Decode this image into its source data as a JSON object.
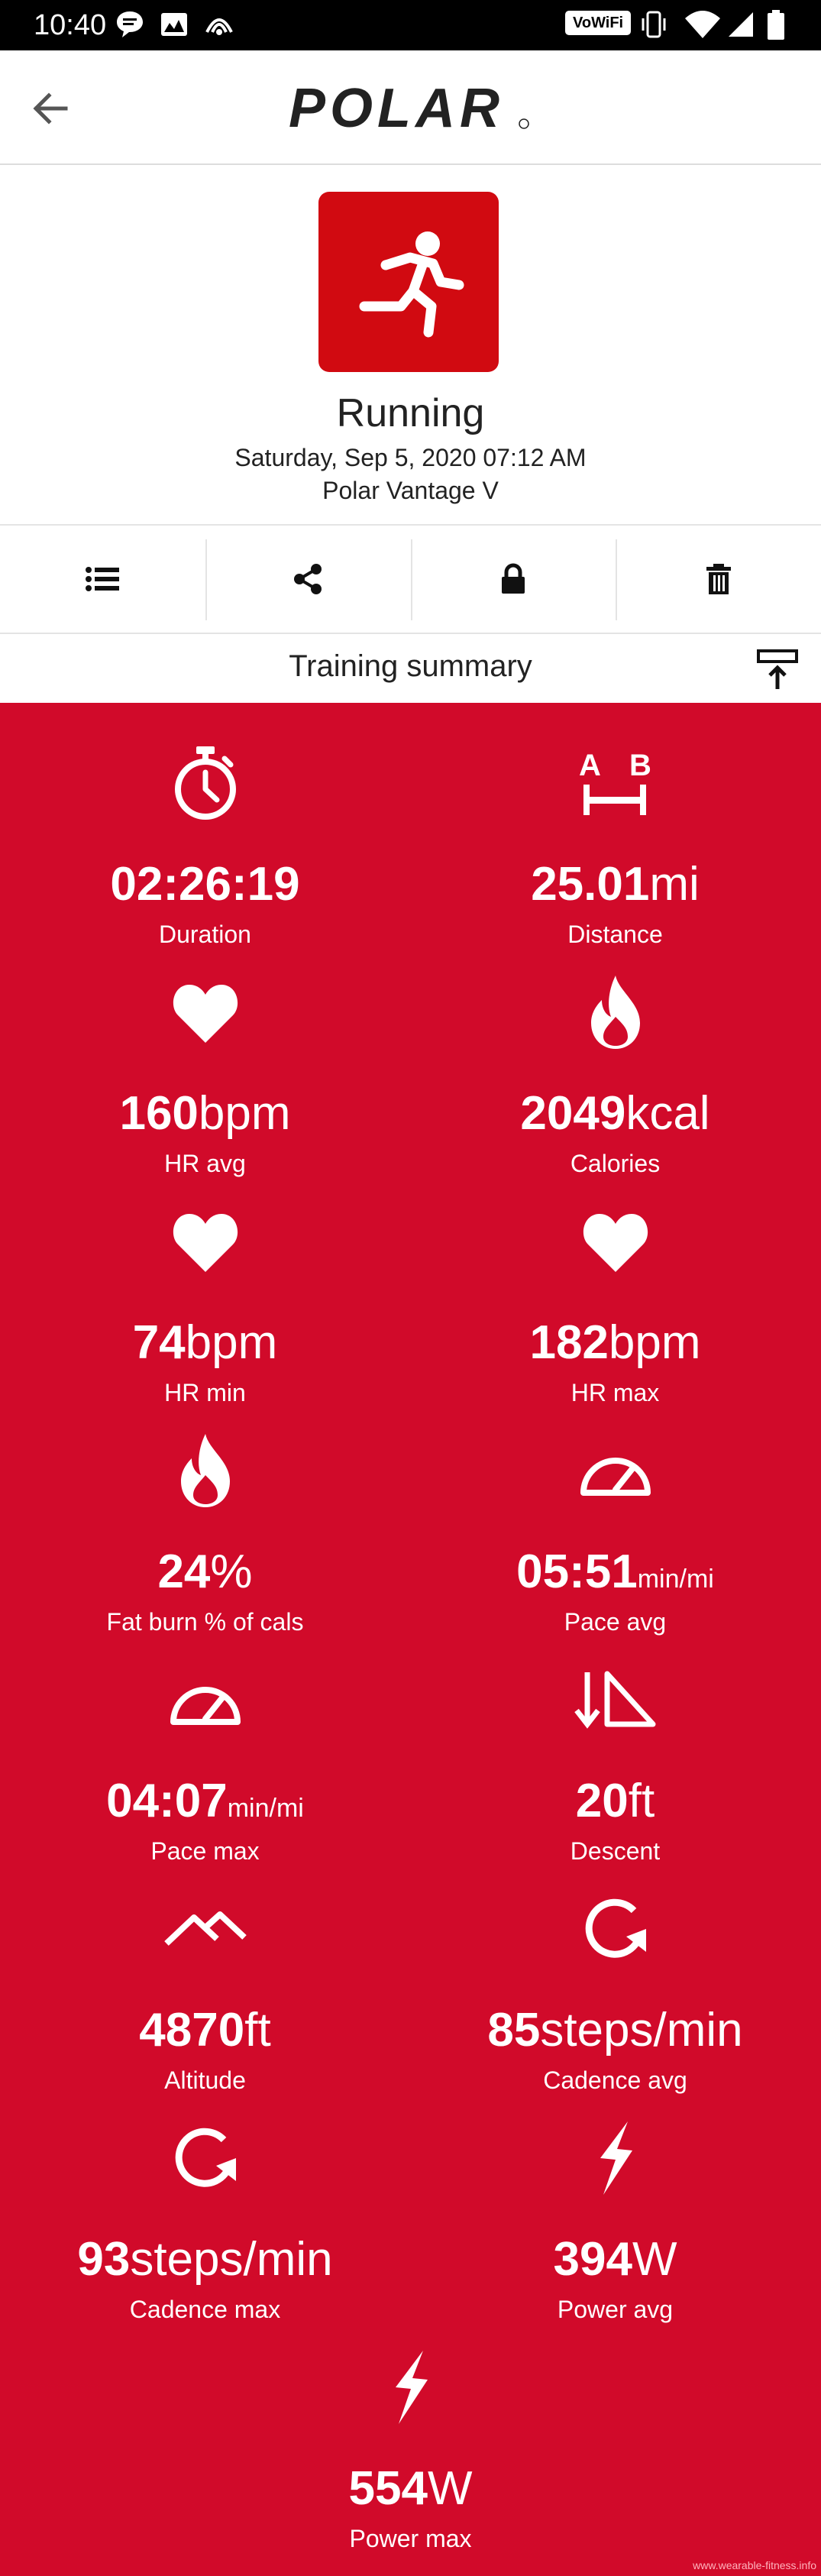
{
  "status_bar": {
    "time": "10:40",
    "volte": "VoWiFi"
  },
  "app": {
    "brand": "POLAR"
  },
  "session": {
    "sport": "Running",
    "datetime": "Saturday, Sep 5, 2020 07:12 AM",
    "device": "Polar Vantage V"
  },
  "actions": [
    {
      "name": "details",
      "icon": "list-icon"
    },
    {
      "name": "share",
      "icon": "share-icon"
    },
    {
      "name": "privacy",
      "icon": "lock-icon"
    },
    {
      "name": "delete",
      "icon": "trash-icon"
    }
  ],
  "summary": {
    "title": "Training summary",
    "metrics": [
      {
        "key": "duration",
        "icon": "stopwatch-icon",
        "value": "02:26:19",
        "unit": "",
        "label": "Duration"
      },
      {
        "key": "distance",
        "icon": "distance-ab-icon",
        "value": "25.01",
        "unit": "mi",
        "label": "Distance"
      },
      {
        "key": "hr_avg",
        "icon": "heart-icon",
        "value": "160",
        "unit": "bpm",
        "label": "HR avg"
      },
      {
        "key": "calories",
        "icon": "flame-icon",
        "value": "2049",
        "unit": "kcal",
        "label": "Calories"
      },
      {
        "key": "hr_min",
        "icon": "heart-icon",
        "value": "74",
        "unit": "bpm",
        "label": "HR min"
      },
      {
        "key": "hr_max",
        "icon": "heart-icon",
        "value": "182",
        "unit": "bpm",
        "label": "HR max"
      },
      {
        "key": "fat_burn",
        "icon": "flame-icon",
        "value": "24",
        "unit": "%",
        "label": "Fat burn % of cals"
      },
      {
        "key": "pace_avg",
        "icon": "gauge-icon",
        "value": "05:51",
        "unit": "min/mi",
        "label": "Pace avg"
      },
      {
        "key": "pace_max",
        "icon": "gauge-icon",
        "value": "04:07",
        "unit": "min/mi",
        "label": "Pace max"
      },
      {
        "key": "descent",
        "icon": "descent-icon",
        "value": "20",
        "unit": "ft",
        "label": "Descent"
      },
      {
        "key": "altitude",
        "icon": "mountain-icon",
        "value": "4870",
        "unit": "ft",
        "label": "Altitude"
      },
      {
        "key": "cadence_avg",
        "icon": "cadence-icon",
        "value": "85",
        "unit": "steps/min",
        "label": "Cadence avg"
      },
      {
        "key": "cadence_max",
        "icon": "cadence-icon",
        "value": "93",
        "unit": "steps/min",
        "label": "Cadence max"
      },
      {
        "key": "power_avg",
        "icon": "lightning-icon",
        "value": "394",
        "unit": "W",
        "label": "Power avg"
      },
      {
        "key": "power_max",
        "icon": "lightning-icon",
        "value": "554",
        "unit": "W",
        "label": "Power max"
      }
    ]
  },
  "colors": {
    "accent": "#d10a2a",
    "tile": "#d10a11"
  }
}
